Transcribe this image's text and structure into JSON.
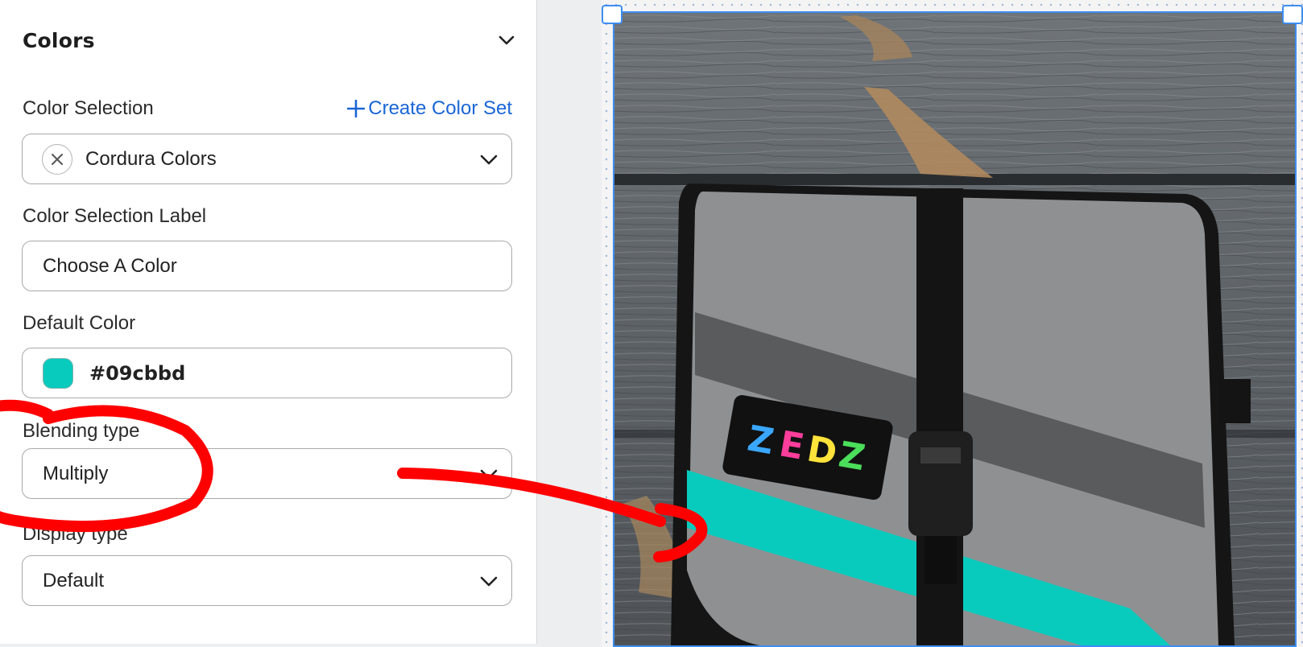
{
  "panel": {
    "section_title": "Colors",
    "color_selection": {
      "label": "Color Selection",
      "create_link": "Create Color Set",
      "create_link_icon": "plus-icon",
      "value": "Cordura Colors"
    },
    "color_selection_label": {
      "label": "Color Selection Label",
      "value": "Choose A Color"
    },
    "default_color": {
      "label": "Default Color",
      "hex": "#09cbbd",
      "swatch_color": "#09cbbd"
    },
    "blending_type": {
      "label": "Blending type",
      "value": "Multiply"
    },
    "display_type": {
      "label": "Display type",
      "value": "Default"
    }
  },
  "colors": {
    "accent": "#1a66d6",
    "selection_outline": "#3d8df0",
    "annotation": "#ff0000",
    "fabric_stripe": "#09cbbd"
  }
}
